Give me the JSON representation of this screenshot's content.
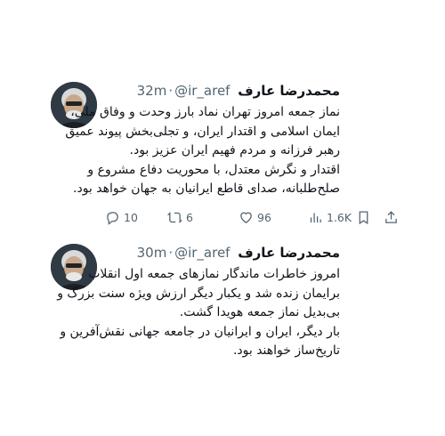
{
  "tweets": [
    {
      "name": "محمدرضا عارف",
      "handle": "@ir_aref",
      "separator": "·",
      "time": "32m",
      "lines": [
        "نماز جمعه امروز تهران نماد بارز وحدت و وفاق ملی،",
        "ایمان اسلامی و اقتدار ایران، و تجلی‌بخش پیوند عمیق",
        "رهبر فرزانه و مردم فهیم ایران عزیز بود.",
        "اقتدار و نگرش معتدل، با محوریت دفاع مشروع و",
        "صلح‌طلبانه، صدای قاطع ایرانیان به جهان خواهد بود."
      ],
      "actions": {
        "replies": "10",
        "reposts": "6",
        "likes": "96",
        "views": "1.6K"
      }
    },
    {
      "name": "محمدرضا عارف",
      "handle": "@ir_aref",
      "separator": "·",
      "time": "30m",
      "lines": [
        "امروز خاطرات ماندگار نمازهای جمعه اول انقلاب",
        "برایمان زنده شد و یکبار دیگر ارزش ویژه سنت بزرگ و",
        "بی‌بدیل نماز جمعه هویدا گشت.",
        "بار دیگر، ایران و ایرانیان در جامعه جهانی نقش‌آفرین و",
        "تاریخ‌ساز خواهند بود."
      ]
    }
  ],
  "icons": {
    "reply": "reply-icon",
    "repost": "repost-icon",
    "like": "heart-icon",
    "views": "views-icon",
    "bookmark": "bookmark-icon",
    "share": "share-icon"
  },
  "colors": {
    "text": "#0f1419",
    "secondary": "#536471"
  }
}
